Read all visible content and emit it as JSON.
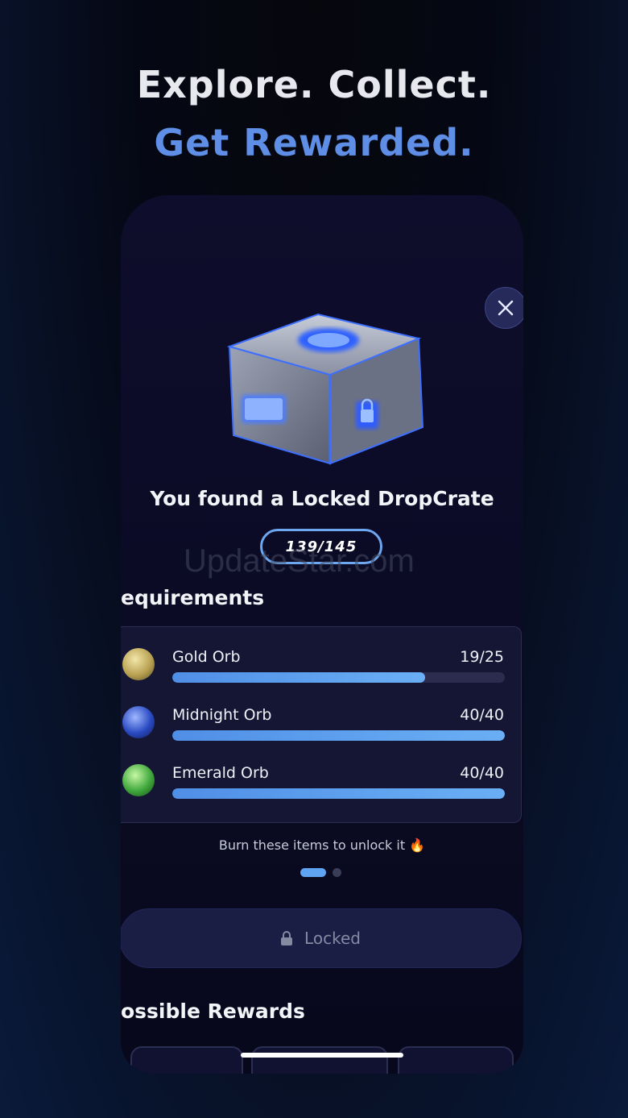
{
  "hero": {
    "line1": "Explore. Collect.",
    "line2": "Get Rewarded."
  },
  "crate": {
    "title": "You found a Locked DropCrate",
    "counter": "139/145"
  },
  "watermark": "UpdateStar.com",
  "requirements": {
    "title": "equirements",
    "items": [
      {
        "name": "Gold Orb",
        "count": "19/25",
        "progress": 0.76,
        "icon": "gold-orb-icon"
      },
      {
        "name": "Midnight Orb",
        "count": "40/40",
        "progress": 1.0,
        "icon": "midnight-orb-icon"
      },
      {
        "name": "Emerald Orb",
        "count": "40/40",
        "progress": 1.0,
        "icon": "emerald-orb-icon"
      }
    ],
    "hint": "Burn these items to unlock it 🔥"
  },
  "pager": {
    "pages": 2,
    "active": 1
  },
  "locked_button": {
    "label": "Locked",
    "icon": "lock-icon"
  },
  "rewards": {
    "title": "ossible Rewards"
  },
  "colors": {
    "accent": "#5e8ee6",
    "progress": "#5fa4f2",
    "gold_orb": "#c9b76a",
    "midnight_orb": "#2b4fbf",
    "emerald_orb": "#3fa83c"
  }
}
